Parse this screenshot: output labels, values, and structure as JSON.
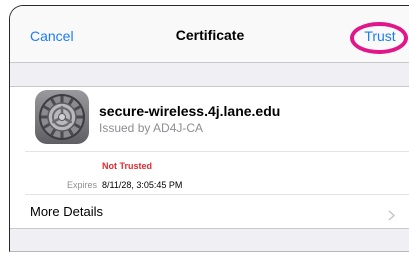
{
  "navbar": {
    "cancel_label": "Cancel",
    "title": "Certificate",
    "trust_label": "Trust"
  },
  "certificate": {
    "icon": "gear-icon",
    "name": "secure-wireless.4j.lane.edu",
    "issuer": "Issued by AD4J-CA",
    "status": "Not Trusted",
    "expires_label": "Expires",
    "expires_value": "8/11/28, 3:05:45 PM"
  },
  "more_details": {
    "label": "More Details",
    "icon": "chevron-right-icon"
  },
  "colors": {
    "accent": "#1e7bf6",
    "annotation_circle": "#e0168a",
    "warning": "#e8282f"
  }
}
